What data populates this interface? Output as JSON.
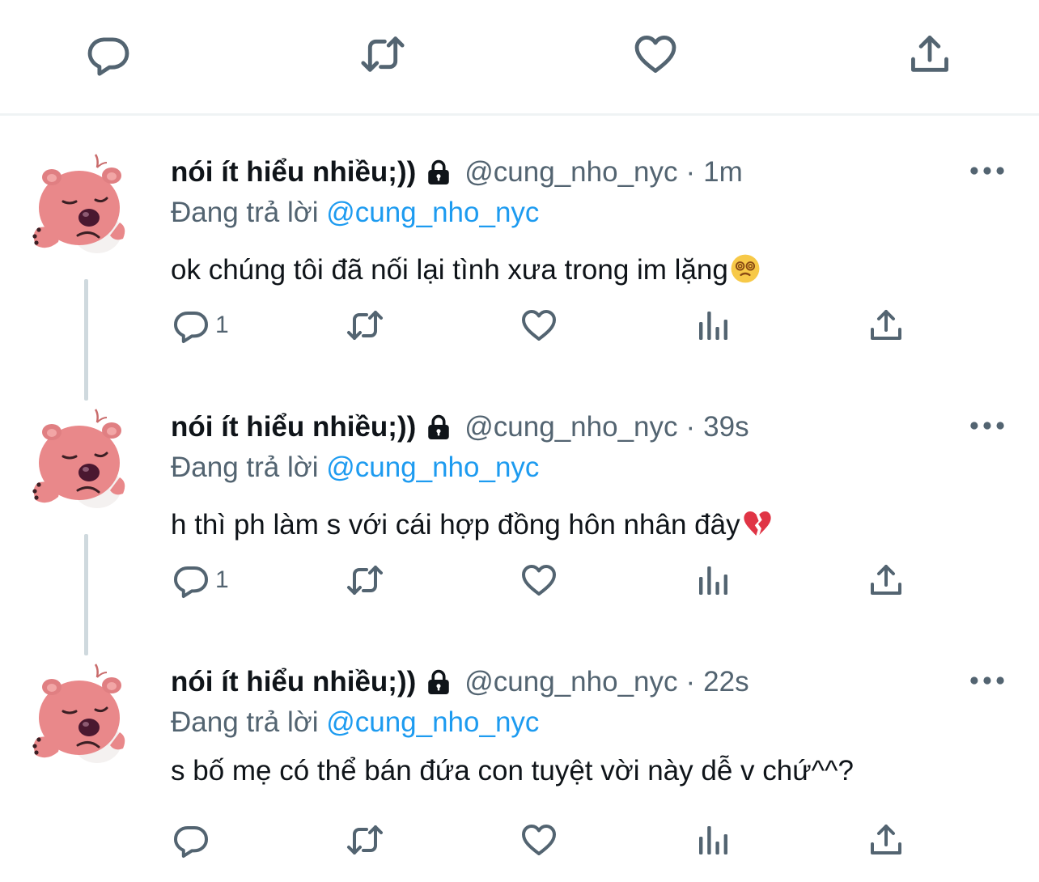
{
  "top_actions": {
    "reply": "reply-icon",
    "retweet": "retweet-icon",
    "like": "heart-icon",
    "share": "share-icon"
  },
  "colors": {
    "text": "#0f1419",
    "secondary": "#536471",
    "link": "#1d9bf0",
    "divider": "#eff3f4",
    "thread_line": "#cfd9de"
  },
  "tweets": [
    {
      "display_name": "nói ít hiểu nhiều;))",
      "handle": "@cung_nho_nyc",
      "separator": "·",
      "time": "1m",
      "reply_prefix": "Đang trả lời",
      "reply_to": "@cung_nho_nyc",
      "text": "ok chúng tôi đã nối lại tình xưa trong im lặng",
      "emoji": "dizzy-face-emoji",
      "reply_count": "1"
    },
    {
      "display_name": "nói ít hiểu nhiều;))",
      "handle": "@cung_nho_nyc",
      "separator": "·",
      "time": "39s",
      "reply_prefix": "Đang trả lời",
      "reply_to": "@cung_nho_nyc",
      "text": "h thì ph làm s với cái hợp đồng hôn nhân đây",
      "emoji": "broken-heart-emoji",
      "reply_count": "1"
    },
    {
      "display_name": "nói ít hiểu nhiều;))",
      "handle": "@cung_nho_nyc",
      "separator": "·",
      "time": "22s",
      "reply_prefix": "Đang trả lời",
      "reply_to": "@cung_nho_nyc",
      "text": "s bố mẹ có thể bán đứa con tuyệt vời này dễ v chứ^^?",
      "emoji": "",
      "reply_count": ""
    }
  ]
}
